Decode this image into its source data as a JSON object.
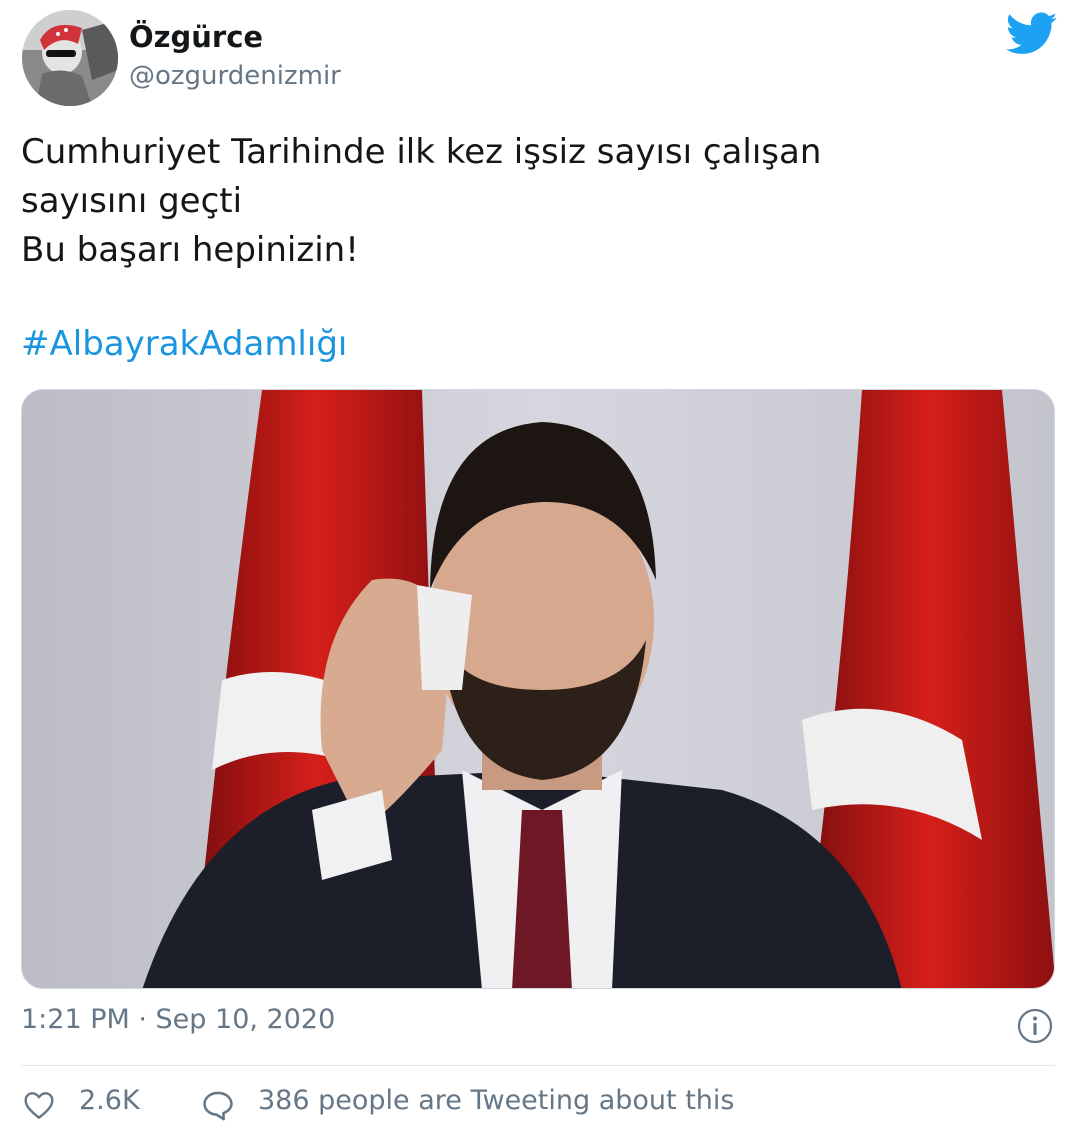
{
  "user": {
    "display_name": "Özgürce",
    "handle": "@ozgurdenizmir"
  },
  "tweet": {
    "lines": [
      "Cumhuriyet Tarihinde ilk kez işsiz sayısı çalışan",
      "sayısını geçti",
      "Bu başarı hepinizin!"
    ],
    "hashtag": "#AlbayrakAdamlığı"
  },
  "meta": {
    "timestamp": "1:21 PM · Sep 10, 2020"
  },
  "actions": {
    "like_count": "2.6K",
    "reply_text": "386 people are Tweeting about this"
  },
  "icons": {
    "brand": "twitter-bird-icon",
    "info": "info-icon",
    "like": "heart-icon",
    "reply": "speech-bubble-icon"
  },
  "colors": {
    "brand": "#1da1f2",
    "hashtag": "#1b95e0",
    "secondary_text": "#657786",
    "primary_text": "#14171a",
    "divider": "#e1e8ed"
  }
}
